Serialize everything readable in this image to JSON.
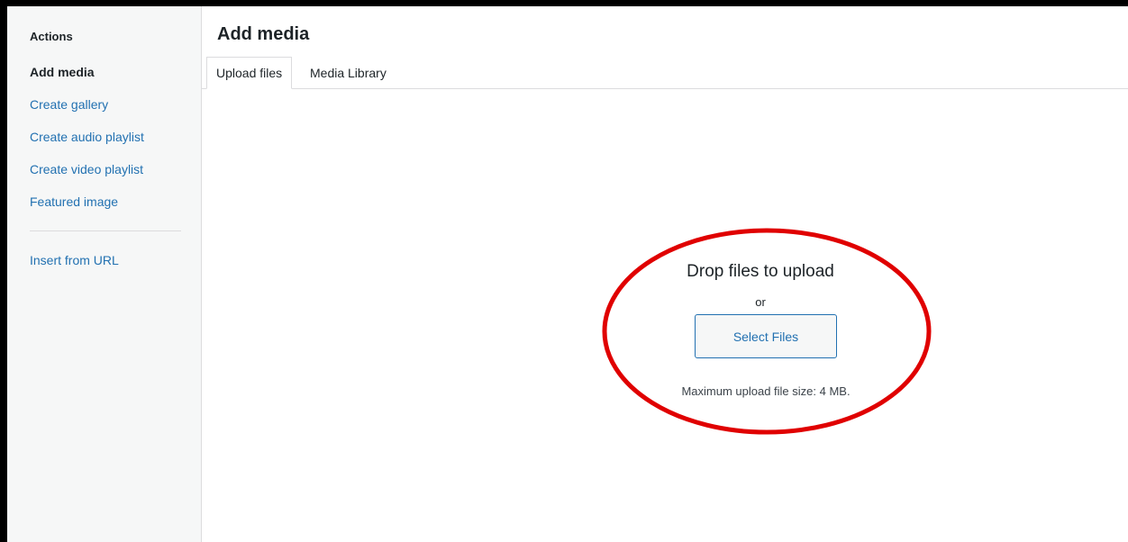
{
  "sidebar": {
    "heading": "Actions",
    "items": [
      {
        "label": "Add media",
        "active": true
      },
      {
        "label": "Create gallery",
        "active": false
      },
      {
        "label": "Create audio playlist",
        "active": false
      },
      {
        "label": "Create video playlist",
        "active": false
      },
      {
        "label": "Featured image",
        "active": false
      }
    ],
    "secondary_items": [
      {
        "label": "Insert from URL"
      }
    ]
  },
  "main": {
    "title": "Add media",
    "tabs": [
      {
        "label": "Upload files",
        "active": true
      },
      {
        "label": "Media Library",
        "active": false
      }
    ],
    "upload": {
      "drop_text": "Drop files to upload",
      "or_text": "or",
      "button_label": "Select Files",
      "max_size_text": "Maximum upload file size: 4 MB."
    }
  },
  "colors": {
    "link": "#2271b1",
    "text": "#1d2327",
    "sidebar_bg": "#f6f7f7",
    "border": "#dcdcde",
    "annotation": "#e00000",
    "outer_frame": "#000000"
  }
}
